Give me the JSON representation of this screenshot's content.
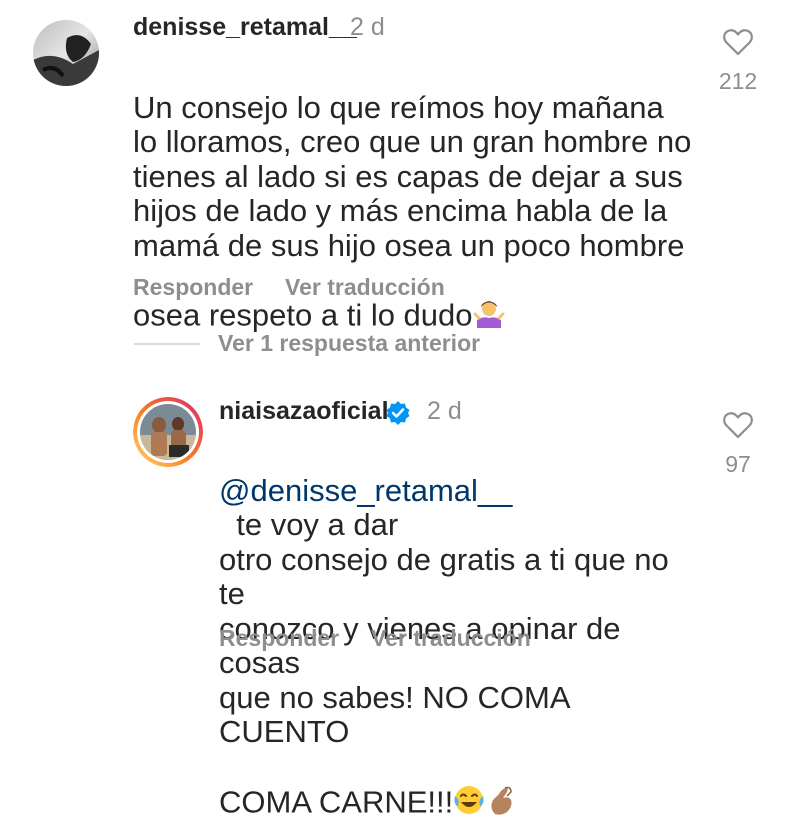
{
  "comments": [
    {
      "username": "denisse_retamal__",
      "time": "2 d",
      "text": "Un consejo lo que reímos hoy mañana\nlo lloramos, creo que un gran hombre no\ntienes al lado si es capas de dejar a sus\nhijos de lado y más encima habla de la\nmamá de sus hijo osea un poco hombre\nosea respeto a ti lo dudo",
      "emoji": "person-shrugging",
      "likes": "212",
      "reply_label": "Responder",
      "translate_label": "Ver traducción"
    },
    {
      "username": "niaisazaoficial",
      "verified": true,
      "time": "2 d",
      "mention": "@denisse_retamal__",
      "text_after_mention": "  te voy a dar",
      "text_rest": "otro consejo de gratis a ti que no te\nconozco y vienes a opinar de cosas\nque no sabes! NO COMA CUENTO\nCOMA CARNE!!!",
      "emojis": [
        "face-with-tears-of-joy",
        "pinching-hand"
      ],
      "likes": "97",
      "reply_label": "Responder",
      "translate_label": "Ver traducción"
    }
  ],
  "replies_toggle": "Ver 1 respuesta anterior",
  "colors": {
    "text": "#262626",
    "secondary": "#8e8e8e",
    "mention": "#00376b",
    "verified": "#0095f6",
    "story_ring_start": "#feda75",
    "story_ring_end": "#d62976"
  }
}
